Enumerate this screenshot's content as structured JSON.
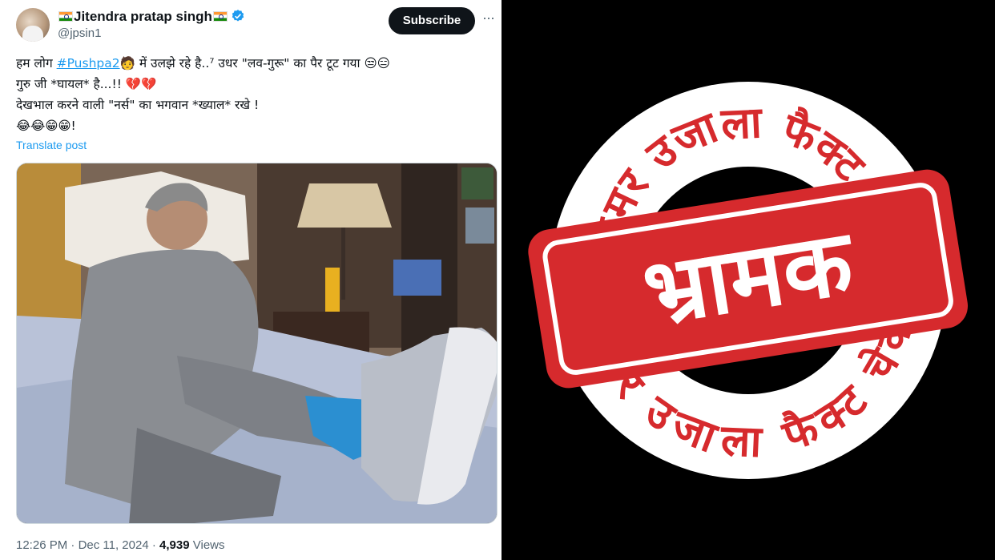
{
  "tweet": {
    "author_name": "Jitendra pratap singh",
    "handle": "@jpsin1",
    "subscribe_label": "Subscribe",
    "more_label": "···",
    "text_line1_prefix": "हम लोग ",
    "hashtag": "#Pushpa2",
    "text_line1_suffix": "  में उलझे रहे है..⁷ उधर \"लव-गुरू\" का पैर टूट गया 😒😑",
    "text_line2": "गुरु जी *घायल* है...!! 💔💔",
    "text_line3": "देखभाल करने वाली \"नर्स\" का भगवान *ख्याल* रखे !",
    "text_line4": "😂😂😁😁!",
    "translate_label": "Translate post",
    "time": "12:26 PM",
    "date": "Dec 11, 2024",
    "views_count": "4,939",
    "views_label": "Views"
  },
  "stamp": {
    "verdict": "भ्रामक",
    "ring_text_top": "अमर उजाला फैक्ट चेक",
    "ring_text_bottom": "अमर उजाला फैक्ट चेक"
  },
  "colors": {
    "link_blue": "#1d9bf0",
    "stamp_red": "#d62a2d",
    "subscribe_bg": "#0f1419"
  }
}
